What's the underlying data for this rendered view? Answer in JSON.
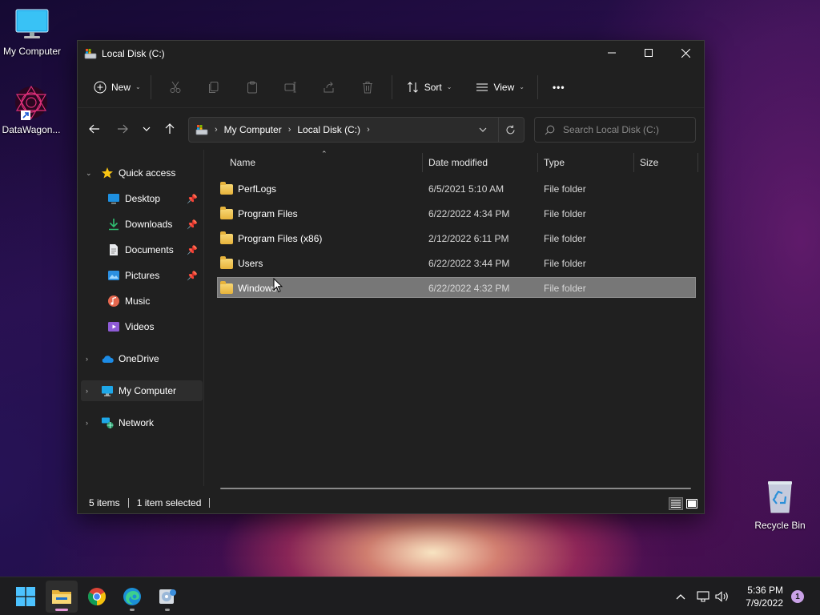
{
  "desktop": {
    "icons": [
      {
        "label": "My Computer",
        "icon": "monitor-icon"
      },
      {
        "label": "DataWagon...",
        "icon": "datawagon-shortcut-icon"
      },
      {
        "label": "Recycle Bin",
        "icon": "recycle-bin-icon"
      }
    ]
  },
  "window": {
    "title": "Local Disk (C:)",
    "controls": {
      "minimize": "—",
      "maximize": "☐",
      "close": "✕"
    }
  },
  "commandbar": {
    "new_label": "New",
    "sort_label": "Sort",
    "view_label": "View",
    "more_label": "•••"
  },
  "navbar": {
    "breadcrumbs": [
      "My Computer",
      "Local Disk (C:)"
    ],
    "search_placeholder": "Search Local Disk (C:)"
  },
  "sidebar": {
    "items": [
      {
        "label": "Quick access",
        "icon": "star-icon"
      },
      {
        "label": "Desktop",
        "icon": "desktop-icon"
      },
      {
        "label": "Downloads",
        "icon": "download-icon"
      },
      {
        "label": "Documents",
        "icon": "document-icon"
      },
      {
        "label": "Pictures",
        "icon": "pictures-icon"
      },
      {
        "label": "Music",
        "icon": "music-icon"
      },
      {
        "label": "Videos",
        "icon": "video-icon"
      },
      {
        "label": "OneDrive",
        "icon": "cloud-icon"
      },
      {
        "label": "My Computer",
        "icon": "computer-icon"
      },
      {
        "label": "Network",
        "icon": "network-icon"
      }
    ]
  },
  "table": {
    "columns": [
      "Name",
      "Date modified",
      "Type",
      "Size"
    ],
    "rows": [
      {
        "name": "PerfLogs",
        "date": "6/5/2021 5:10 AM",
        "type": "File folder",
        "size": ""
      },
      {
        "name": "Program Files",
        "date": "6/22/2022 4:34 PM",
        "type": "File folder",
        "size": ""
      },
      {
        "name": "Program Files (x86)",
        "date": "2/12/2022 6:11 PM",
        "type": "File folder",
        "size": ""
      },
      {
        "name": "Users",
        "date": "6/22/2022 3:44 PM",
        "type": "File folder",
        "size": ""
      },
      {
        "name": "Windows",
        "date": "6/22/2022 4:32 PM",
        "type": "File folder",
        "size": ""
      }
    ]
  },
  "status": {
    "item_count": "5 items",
    "selected": "1 item selected"
  },
  "taskbar": {
    "time": "5:36 PM",
    "date": "7/9/2022",
    "notifications": "1"
  },
  "colors": {
    "window_bg": "#202020",
    "selected_row": "#777777",
    "accent": "#4cc2ff"
  }
}
